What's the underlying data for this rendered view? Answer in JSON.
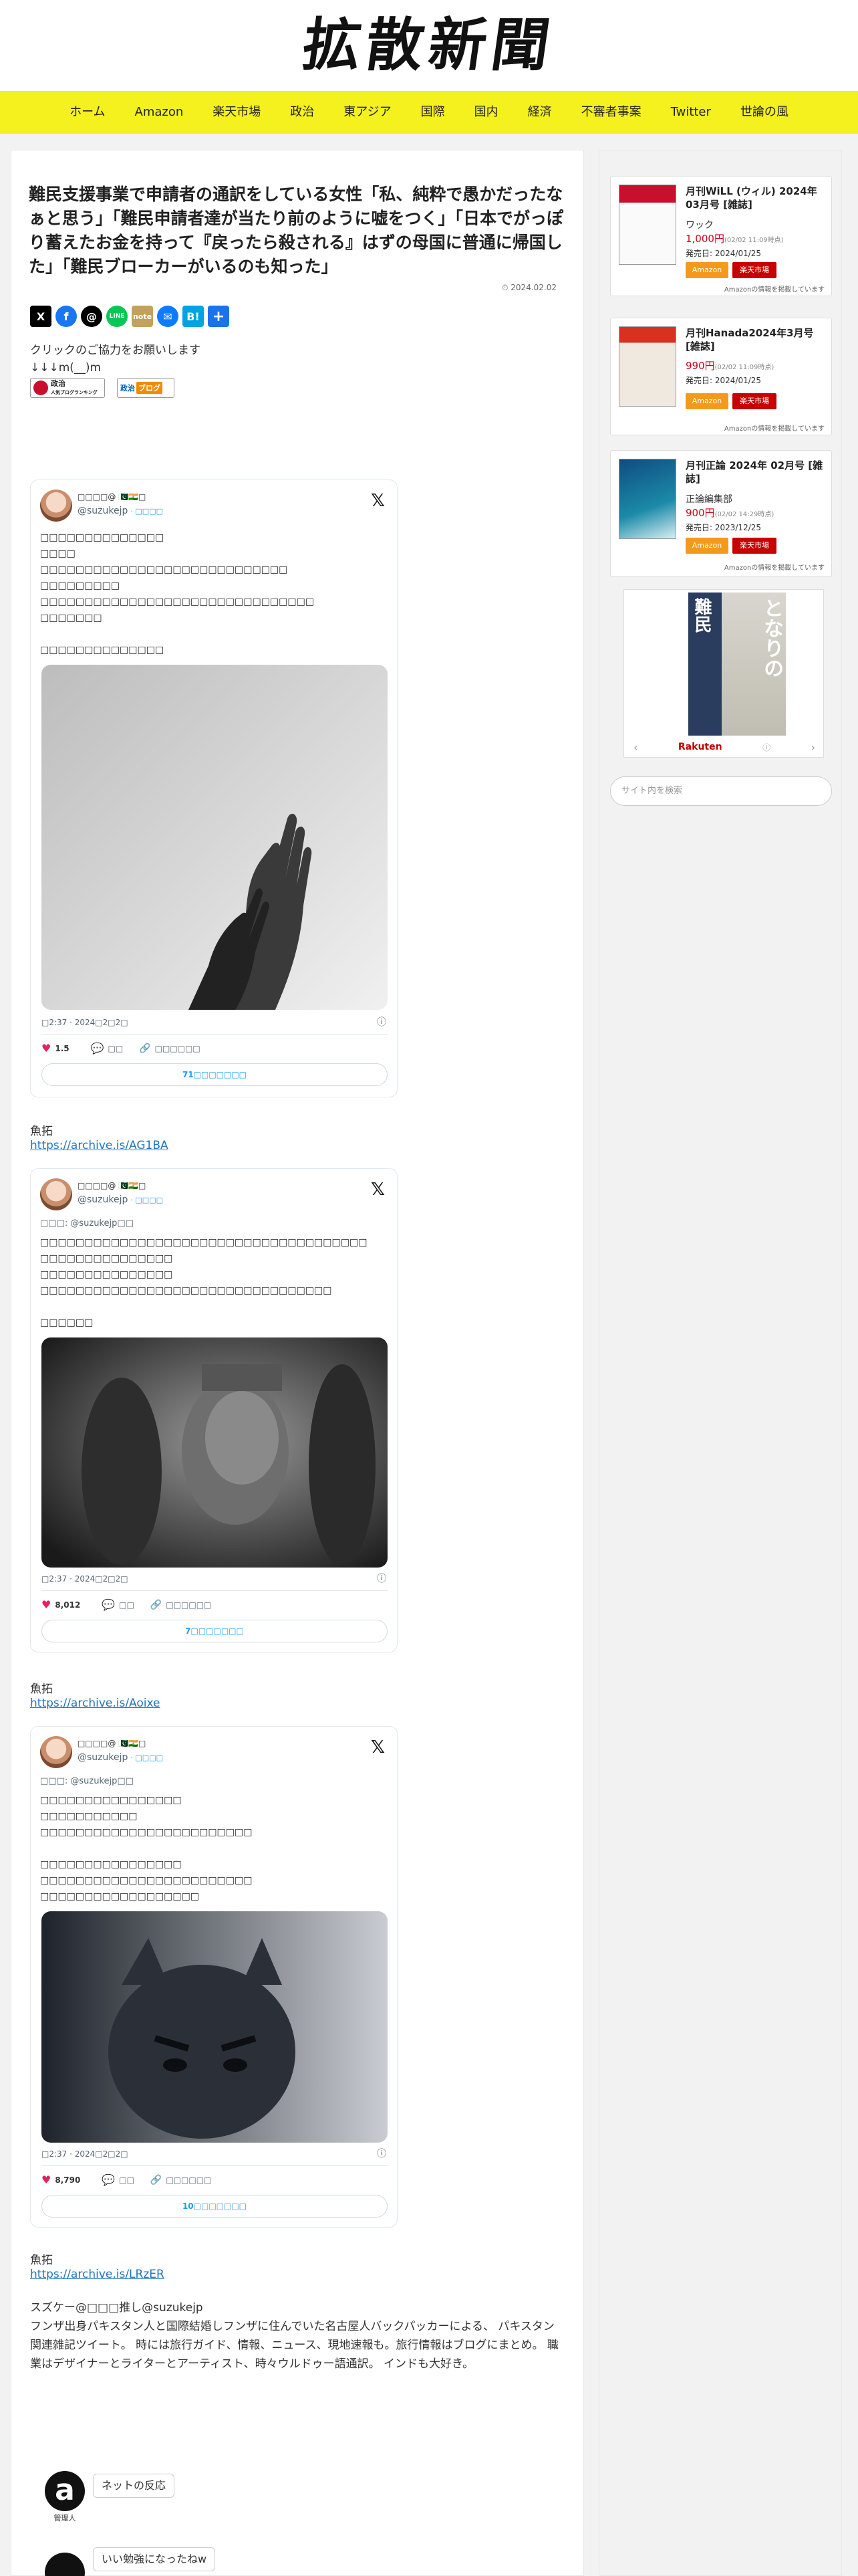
{
  "site": {
    "logo": "拡散新聞"
  },
  "nav": [
    "ホーム",
    "Amazon",
    "楽天市場",
    "政治",
    "東アジア",
    "国際",
    "国内",
    "経済",
    "不審者事案",
    "Twitter",
    "世論の風"
  ],
  "article": {
    "title": "難民支援事業で申請者の通訳をしている女性「私、純粋で愚かだったなぁと思う」「難民申請者達が当たり前のように嘘をつく」「日本でがっぽり蓄えたお金を持って『戻ったら殺される』はずの母国に普通に帰国した」「難民ブローカーがいるのも知った」",
    "date": "2024.02.02",
    "share_icons": [
      "x-icon",
      "facebook-icon",
      "threads-icon",
      "line-icon",
      "note-icon",
      "messenger-icon",
      "hatena-icon",
      "plus-icon"
    ],
    "cooperate_line1": "クリックのご協力をお願いします",
    "cooperate_line2": "↓↓↓m(__)m",
    "badge1_a": "政治",
    "badge1_b": "人気ブログランキング",
    "badge2_a": "政治",
    "badge2_b": "ブログ"
  },
  "tweets": [
    {
      "name": "□□□□@ 🇵🇰🇮🇳□",
      "handle": "@suzukejp",
      "follow": "· □□□□",
      "body": "□□□□□□□□□□□□□□\n□□□□\n□□□□□□□□□□□□□□□□□□□□□□□□□□□□\n□□□□□□□□□\n□□□□□□□□□□□□□□□□□□□□□□□□□□□□□□□\n□□□□□□□\n\n□□□□□□□□□□□□□□",
      "time": "□2:37 · 2024□2□2□",
      "likes": "1.5",
      "reply": "□□",
      "copy": "□□□□□□",
      "readmore": "71□□□□□□□"
    },
    {
      "name": "□□□□@ 🇵🇰🇮🇳□",
      "handle": "@suzukejp",
      "follow": "· □□□□",
      "replying": "□□□: @suzukejp□□",
      "body": "□□□□□□□□□□□□□□□□□□□□□□□□□□□□□□□□□□□□□\n□□□□□□□□□□□□□□□\n□□□□□□□□□□□□□□□\n□□□□□□□□□□□□□□□□□□□□□□□□□□□□□□□□□\n\n□□□□□□",
      "time": "□2:37 · 2024□2□2□",
      "likes": "8,012",
      "reply": "□□",
      "copy": "□□□□□□",
      "readmore": "7□□□□□□□"
    },
    {
      "name": "□□□□@ 🇵🇰🇮🇳□",
      "handle": "@suzukejp",
      "follow": "· □□□□",
      "replying": "□□□: @suzukejp□□",
      "body": "□□□□□□□□□□□□□□□□\n□□□□□□□□□□□\n□□□□□□□□□□□□□□□□□□□□□□□□\n\n□□□□□□□□□□□□□□□□\n□□□□□□□□□□□□□□□□□□□□□□□□\n□□□□□□□□□□□□□□□□□□",
      "time": "□2:37 · 2024□2□2□",
      "likes": "8,790",
      "reply": "□□",
      "copy": "□□□□□□",
      "readmore": "10□□□□□□□"
    }
  ],
  "quotes": [
    {
      "label": "魚拓",
      "link": "https://archive.is/AG1BA"
    },
    {
      "label": "魚拓",
      "link": "https://archive.is/Aoixe"
    },
    {
      "label": "魚拓",
      "link": "https://archive.is/LRzER"
    }
  ],
  "author": {
    "line1": "スズケー@□□□推し@suzukejp",
    "line2": "フンザ出身パキスタン人と国際結婚しフンザに住んでいた名古屋人バックパッカーによる、 パキスタン関連雑記ツイート。 時には旅行ガイド、情報、ニュース、現地速報も。旅行情報はブログにまとめ。 職業はデザイナーとライターとアーティスト、時々ウルドゥー語通訳。 インドも大好き。"
  },
  "comments": [
    {
      "icon": "a",
      "name": "管理人",
      "text": "ネットの反応"
    },
    {
      "text": "いい勉強になったねw"
    }
  ],
  "sidebar": {
    "products": [
      {
        "title": "月刊WiLL (ウィル) 2024年03月号 [雑誌]",
        "publisher": "ワック",
        "price": "1,000円",
        "price_time": "(02/02 11:09時点)",
        "date": "発売日: 2024/01/25",
        "btn_amazon": "Amazon",
        "btn_rakuten": "楽天市場",
        "note": "Amazonの情報を掲載しています",
        "cover_color": "#c8102e"
      },
      {
        "title": "月刊Hanada2024年3月号 [雑誌]",
        "price": "990円",
        "price_time": "(02/02 11:09時点)",
        "date": "発売日: 2024/01/25",
        "btn_amazon": "Amazon",
        "btn_rakuten": "楽天市場",
        "note": "Amazonの情報を掲載しています",
        "cover_color": "#d9301f"
      },
      {
        "title": "月刊正論 2024年 02月号 [雑誌]",
        "publisher": "正論編集部",
        "price": "900円",
        "price_time": "(02/02 14:29時点)",
        "date": "発売日: 2023/12/25",
        "btn_amazon": "Amazon",
        "btn_rakuten": "楽天市場",
        "note": "Amazonの情報を掲載しています",
        "cover_color": "#1b6fa8"
      }
    ],
    "rakuten": {
      "book_left": "難民",
      "book_right": "となりの",
      "brand": "Rakuten"
    },
    "search_placeholder": "サイト内を検索"
  }
}
